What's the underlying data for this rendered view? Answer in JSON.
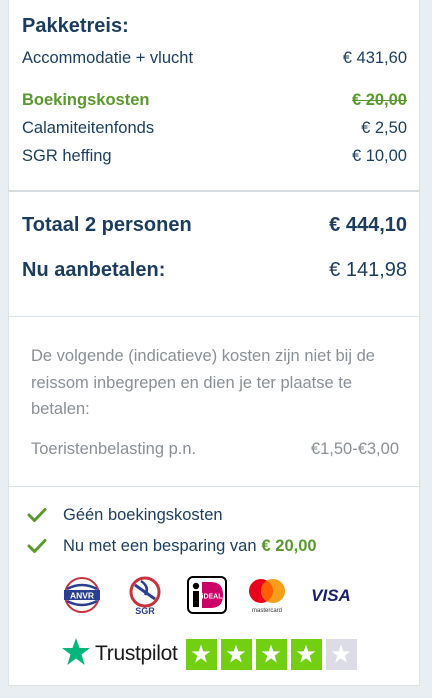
{
  "package": {
    "title": "Pakketreis:",
    "rows": [
      {
        "label": "Accommodatie + vlucht",
        "value": "€ 431,60"
      },
      {
        "label": "Boekingskosten",
        "value": "€ 20,00"
      },
      {
        "label": "Calamiteitenfonds",
        "value": "€ 2,50"
      },
      {
        "label": "SGR heffing",
        "value": "€ 10,00"
      }
    ]
  },
  "totals": {
    "total_label": "Totaal 2 personen",
    "total_value": "€ 444,10",
    "deposit_label": "Nu aanbetalen:",
    "deposit_value": "€ 141,98"
  },
  "extra_costs": {
    "note": "De volgende (indicatieve) kosten zijn niet bij de reissom inbegrepen en dien je ter plaatse te betalen:",
    "tax_label": "Toeristenbelasting p.n.",
    "tax_value": "€1,50-€3,00"
  },
  "benefits": {
    "item1": "Géén boekingskosten",
    "item2_text": "Nu met een besparing van",
    "item2_amount": "€ 20,00"
  },
  "payment_logos": {
    "anvr": "ANVR",
    "sgr": "SGR",
    "ideal": "iDEAL",
    "mastercard": "mastercard",
    "visa": "VISA"
  },
  "trustpilot": {
    "name": "Trustpilot",
    "rating_stars_filled": 4,
    "rating_stars_total": 5
  },
  "colors": {
    "navy": "#1c3d5e",
    "green": "#5a9a2c",
    "trustpilot_green": "#00b67a",
    "star_gray": "#dcdce6"
  }
}
